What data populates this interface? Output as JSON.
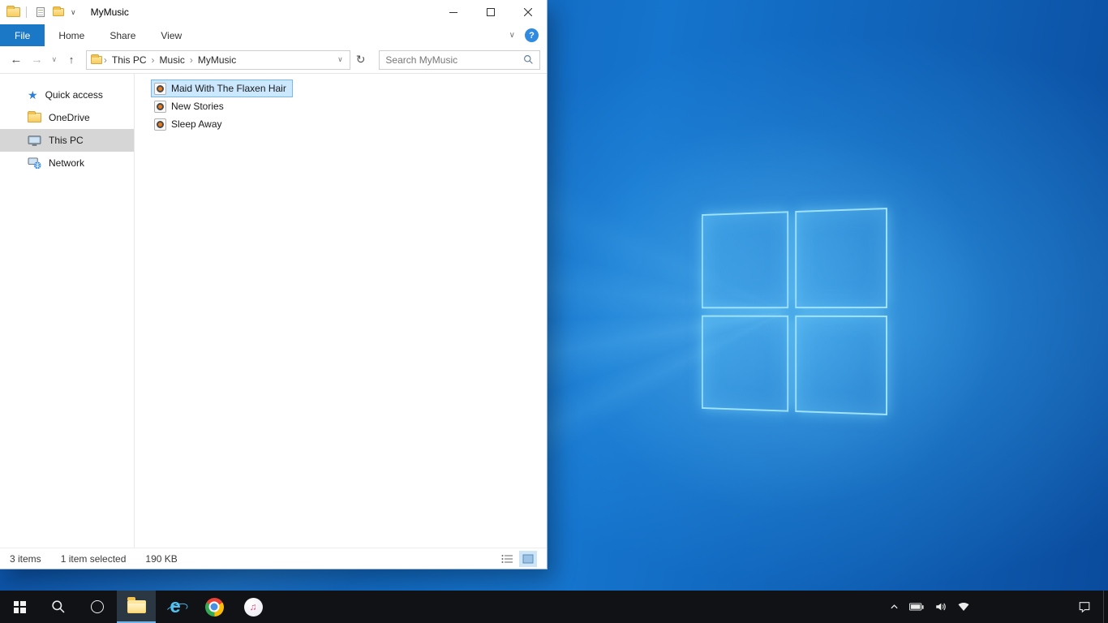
{
  "glyphs": {
    "back": "←",
    "forward": "→",
    "up": "↑",
    "refresh": "↻",
    "caret": "∨",
    "breadcrumb_sep": "›",
    "help": "?",
    "star": "★",
    "note": "♫",
    "ie": "e"
  },
  "colors": {
    "ribbon_file_tab": "#1a78c6",
    "selection_fill": "#cce8ff",
    "selection_border": "#7ab8ec",
    "sidebar_selected": "#d6d6d6",
    "taskbar": "#101216",
    "taskbar_active_underline": "#6fb3e8",
    "wallpaper_dark": "#0a4a9c",
    "wallpaper_light": "#1574cd",
    "logo_edge": "#aaebff"
  },
  "window": {
    "title": "MyMusic",
    "tabs": [
      {
        "label": "File",
        "active": true
      },
      {
        "label": "Home"
      },
      {
        "label": "Share"
      },
      {
        "label": "View"
      }
    ],
    "address": {
      "breadcrumb": [
        "This PC",
        "Music",
        "MyMusic"
      ]
    },
    "search": {
      "placeholder": "Search MyMusic"
    },
    "sidebar": [
      {
        "label": "Quick access",
        "icon": "star-icon"
      },
      {
        "label": "OneDrive",
        "icon": "folder-icon"
      },
      {
        "label": "This PC",
        "icon": "computer-icon",
        "selected": true
      },
      {
        "label": "Network",
        "icon": "network-icon"
      }
    ],
    "files": [
      {
        "name": "Maid With The Flaxen Hair",
        "icon": "music-file-icon",
        "selected": true
      },
      {
        "name": "New Stories",
        "icon": "music-file-icon"
      },
      {
        "name": "Sleep Away",
        "icon": "music-file-icon"
      }
    ],
    "status": {
      "count": "3 items",
      "selected": "1 item selected",
      "size": "190 KB"
    }
  },
  "taskbar": {
    "apps": [
      "start",
      "search",
      "cortana",
      "file-explorer",
      "internet-explorer",
      "chrome",
      "itunes"
    ],
    "active_app": "file-explorer",
    "tray": [
      "chevron-up",
      "battery",
      "volume",
      "wifi"
    ],
    "far_right": "action-center"
  }
}
